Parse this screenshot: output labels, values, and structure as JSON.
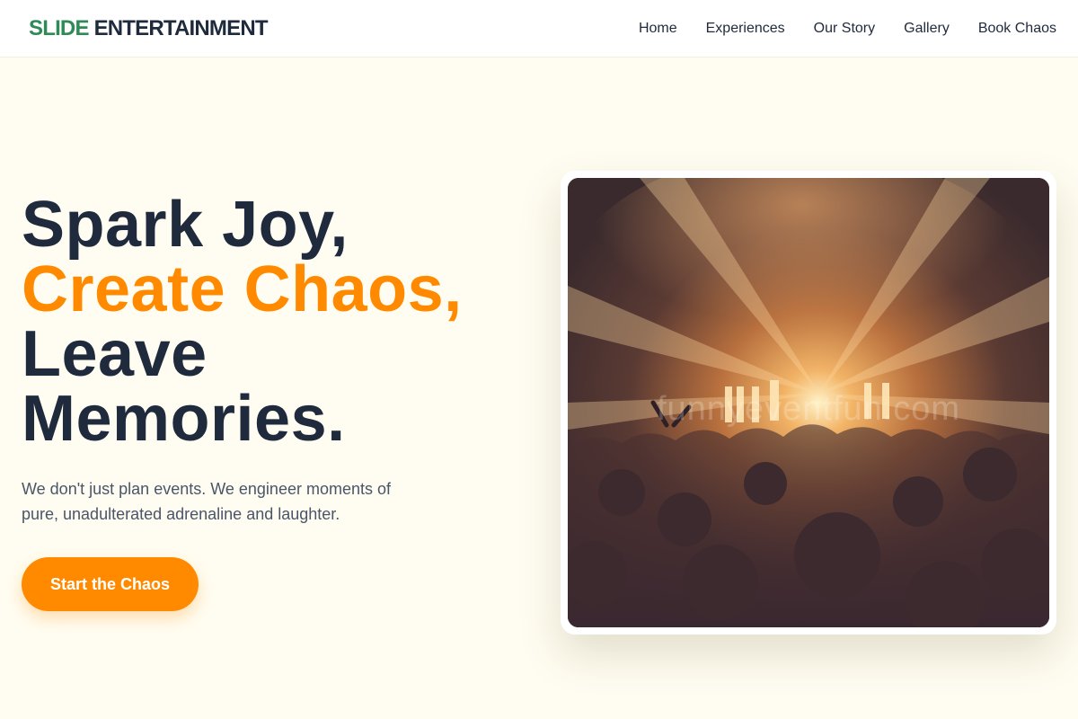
{
  "nav": {
    "brand_accent": "SLIDE",
    "brand_rest": "ENTERTAINMENT",
    "links": [
      "Home",
      "Experiences",
      "Our Story",
      "Gallery",
      "Book Chaos"
    ]
  },
  "hero": {
    "line1": "Spark Joy,",
    "line2": "Create Chaos,",
    "line3": "Leave",
    "line4": "Memories.",
    "subtitle": "We don't just plan events. We engineer moments of pure, unadulterated adrenaline and laughter.",
    "cta_label": "Start the Chaos"
  },
  "photo": {
    "watermark": "funnyeventfun.com"
  },
  "colors": {
    "accent": "#ff8a00",
    "brand_green": "#2e8a57",
    "text_dark": "#1f2a3d",
    "background": "#fffdf1"
  }
}
